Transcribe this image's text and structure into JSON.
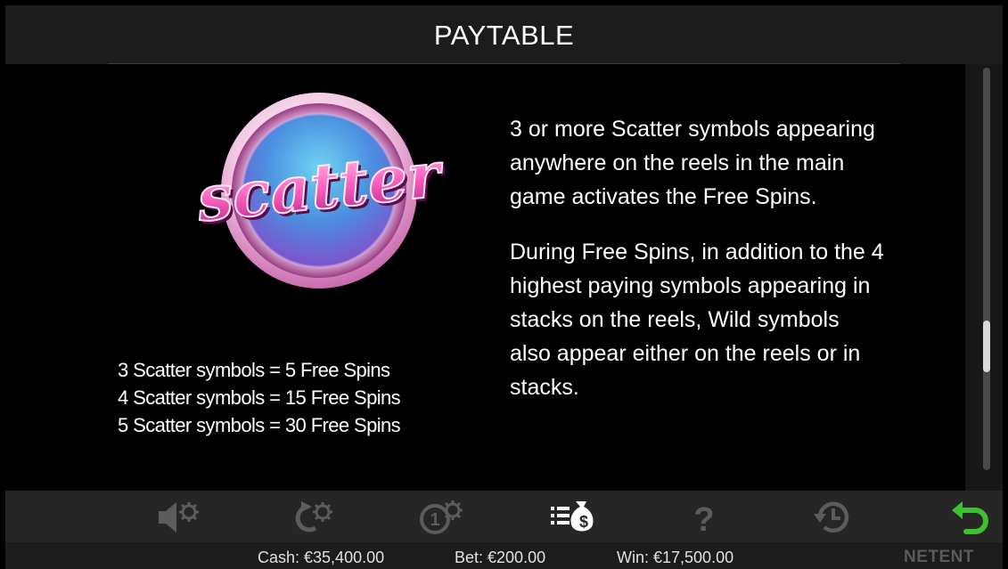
{
  "header": {
    "title": "PAYTABLE"
  },
  "symbol": {
    "name": "Scatter"
  },
  "payouts": [
    "3 Scatter symbols = 5 Free Spins",
    "4 Scatter symbols = 15 Free Spins",
    "5 Scatter symbols = 30 Free Spins"
  ],
  "description": [
    "3 or more Scatter symbols appearing anywhere on the reels in the main game activates the Free Spins.",
    "During Free Spins, in addition to the 4 highest paying symbols appearing in stacks on the reels, Wild symbols also appear either on the reels or in stacks."
  ],
  "toolbar": {
    "icons": [
      "sound-settings-icon",
      "autoplay-settings-icon",
      "bet-settings-icon",
      "paytable-icon",
      "help-icon",
      "history-icon",
      "back-icon"
    ],
    "accent": "#3fbf2f"
  },
  "status": {
    "cash": "Cash: €35,400.00",
    "bet": "Bet: €200.00",
    "win": "Win: €17,500.00"
  },
  "brand": "NETENT",
  "colors": {
    "background": "#000000",
    "header_bg": "#1c1c1c",
    "toolbar_bg": "#262626",
    "icon_gray": "#5c5c5c",
    "icon_active": "#ffffff",
    "back_green": "#3fbf2f"
  }
}
